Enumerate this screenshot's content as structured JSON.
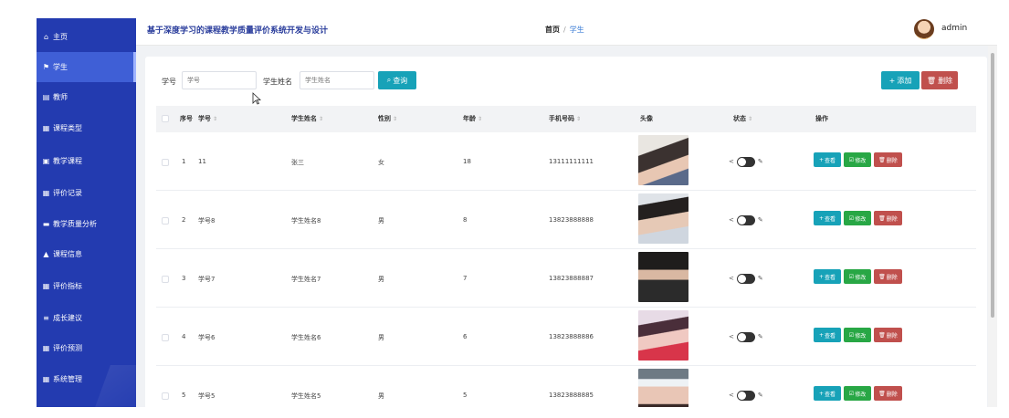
{
  "corner_text": "",
  "sidebar": {
    "items": [
      {
        "icon": "home-icon",
        "glyph": "⌂",
        "label": "主页"
      },
      {
        "icon": "flag-icon",
        "glyph": "⚑",
        "label": "学生",
        "active": true
      },
      {
        "icon": "book-icon",
        "glyph": "▤",
        "label": "教师"
      },
      {
        "icon": "grid-icon",
        "glyph": "▦",
        "label": "课程类型"
      },
      {
        "icon": "image-icon",
        "glyph": "▣",
        "label": "教学课程"
      },
      {
        "icon": "grid-icon",
        "glyph": "▦",
        "label": "评价记录"
      },
      {
        "icon": "monitor-icon",
        "glyph": "▬",
        "label": "教学质量分析"
      },
      {
        "icon": "user-icon",
        "glyph": "▲",
        "label": "课程信息"
      },
      {
        "icon": "table-icon",
        "glyph": "▦",
        "label": "评价指标"
      },
      {
        "icon": "list-icon",
        "glyph": "≡",
        "label": "成长建议"
      },
      {
        "icon": "grid-icon",
        "glyph": "▦",
        "label": "评价预测"
      },
      {
        "icon": "grid-icon",
        "glyph": "▦",
        "label": "系统管理"
      }
    ]
  },
  "header": {
    "title": "基于深度学习的课程教学质量评价系统开发与设计",
    "breadcrumb_home": "首页",
    "breadcrumb_sep": "/",
    "breadcrumb_current": "学生",
    "user_name": "admin"
  },
  "search": {
    "label_id": "学号",
    "placeholder_id": "学号",
    "label_name": "学生姓名",
    "placeholder_name": "学生姓名",
    "query_label": "查询",
    "add_label": "添加",
    "delete_label": "删除"
  },
  "table": {
    "columns": [
      "序号",
      "学号",
      "学生姓名",
      "性别",
      "年龄",
      "手机号码",
      "头像",
      "状态",
      "操作"
    ],
    "rows": [
      {
        "no": "1",
        "id": "11",
        "name": "张三",
        "gender": "女",
        "age": "18",
        "phone": "13111111111"
      },
      {
        "no": "2",
        "id": "学号8",
        "name": "学生姓名8",
        "gender": "男",
        "age": "8",
        "phone": "13823888888"
      },
      {
        "no": "3",
        "id": "学号7",
        "name": "学生姓名7",
        "gender": "男",
        "age": "7",
        "phone": "13823888887"
      },
      {
        "no": "4",
        "id": "学号6",
        "name": "学生姓名6",
        "gender": "男",
        "age": "6",
        "phone": "13823888886"
      },
      {
        "no": "5",
        "id": "学号5",
        "name": "学生姓名5",
        "gender": "男",
        "age": "5",
        "phone": "13823888885"
      }
    ],
    "actions": {
      "view": "查看",
      "edit": "修改",
      "delete": "删除"
    }
  },
  "colors": {
    "sidebar": "#233bb0",
    "primary": "#17a2b8",
    "success": "#28a745",
    "danger": "#c0504d"
  }
}
